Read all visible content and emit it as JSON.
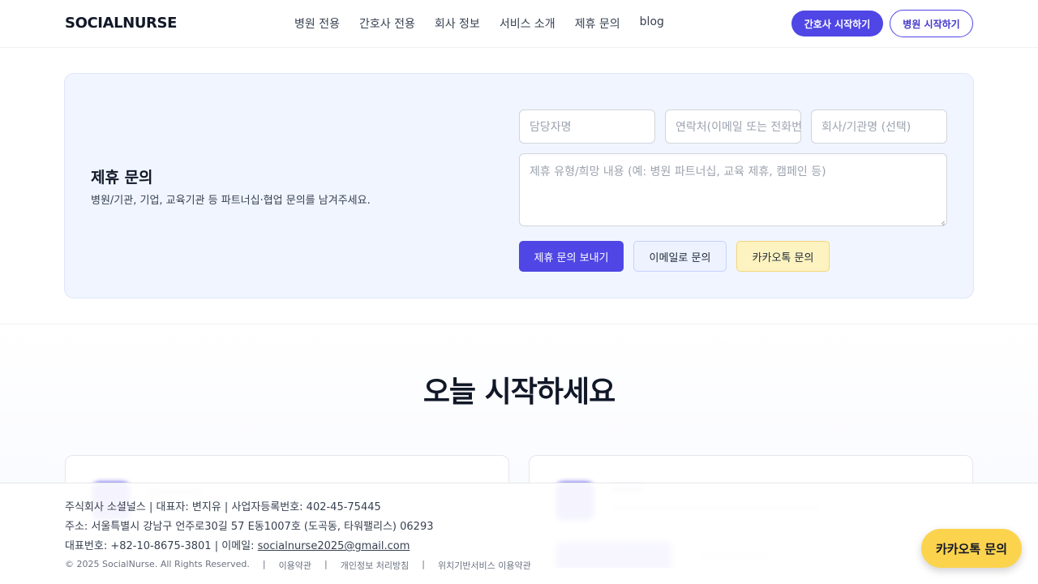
{
  "header": {
    "logo": "SOCIALNURSE",
    "nav": [
      "병원 전용",
      "간호사 전용",
      "회사 정보",
      "서비스 소개",
      "제휴 문의",
      "blog"
    ],
    "nurse_button": "간호사 시작하기",
    "hospital_button": "병원 시작하기"
  },
  "partnership": {
    "title": "제휴 문의",
    "description": "병원/기관, 기업, 교육기관 등 파트너십·협업 문의를 남겨주세요.",
    "name_placeholder": "담당자명",
    "contact_placeholder": "연락처(이메일 또는 전화번호)",
    "company_placeholder": "회사/기관명 (선택)",
    "message_placeholder": "제휴 유형/희망 내용 (예: 병원 파트너십, 교육 제휴, 캠페인 등)",
    "send_button": "제휴 문의 보내기",
    "email_button": "이메일로 문의",
    "kakao_button": "카카오톡 문의"
  },
  "start": {
    "title": "오늘 시작하세요"
  },
  "footer": {
    "company": "주식회사 소셜널스",
    "ceo": "대표자: 변지유",
    "biz_no": "사업자등록번호: 402-45-75445",
    "address": "주소: 서울특별시 강남구 언주로30길 57 E동1007호 (도곡동, 타워팰리스) 06293",
    "phone": "대표번호: +82-10-8675-3801",
    "email_label": "이메일:",
    "email": "socialnurse2025@gmail.com",
    "copyright": "© 2025 SocialNurse. All Rights Reserved.",
    "links": [
      "이용약관",
      "개인정보 처리방침",
      "위치기반서비스 이용약관"
    ],
    "separator": "|"
  },
  "floating": {
    "kakao_label": "카카오톡 문의"
  },
  "colors": {
    "primary": "#4f46e5",
    "kakao": "#fcd34d",
    "card_bg": "#f1f5ff"
  }
}
